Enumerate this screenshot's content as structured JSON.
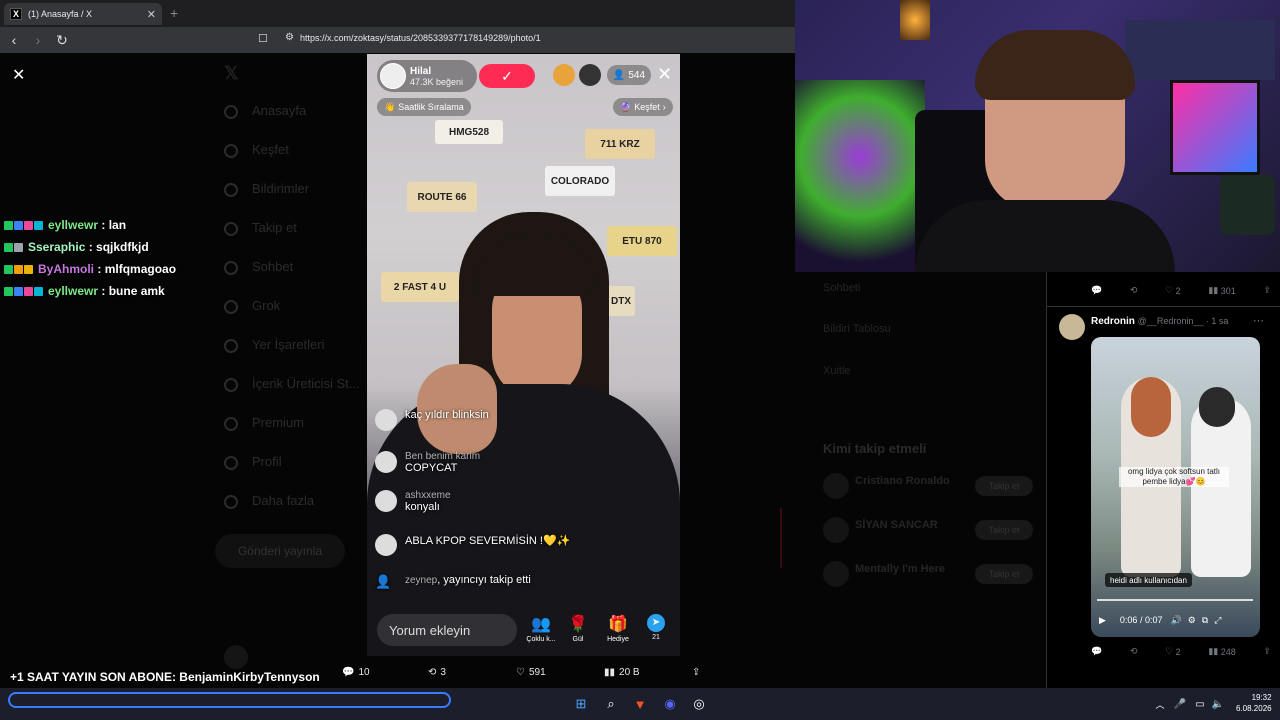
{
  "browser": {
    "tab_title": "(1) Anasayfa / X",
    "favicon": "X",
    "tab_close": "✕",
    "new_tab": "+",
    "url": "https://x.com/zoktasy/status/2085339377178149289/photo/1"
  },
  "x_sidebar": {
    "items": [
      "Anasayfa",
      "Keşfet",
      "Bildirimler",
      "Takip et",
      "Sohbet",
      "Grok",
      "Yer İşaretleri",
      "İçerik Üreticisi St...",
      "Premium",
      "Profil",
      "Daha fazla"
    ],
    "post_button": "Gönderi yayınla"
  },
  "x_right": {
    "rows": [
      "Sohbeti",
      "Bildiri Tablosu",
      "Xuitle"
    ],
    "who_to_follow": "Kimi takip etmeli",
    "suggestions": [
      "Cristiano Ronaldo",
      "SİYAN SANCAR",
      "Mentally I'm Here"
    ],
    "follow_label": "Takip et"
  },
  "chat": [
    {
      "user": "eyllwewr",
      "msg": "lan",
      "color": "#7ee787"
    },
    {
      "user": "Sseraphic",
      "msg": "sqjkdfkjd",
      "color": "#a5f3c4"
    },
    {
      "user": "ByAhmoli",
      "msg": "mlfqmagoao",
      "color": "#c678dd"
    },
    {
      "user": "eyllwewr",
      "msg": "bune amk",
      "color": "#7ee787"
    }
  ],
  "live": {
    "host_name": "Hilal",
    "host_likes": "47.3K beğeni",
    "follow_icon": "✓",
    "viewers": "544",
    "tag_left": "Saatlik Sıralama",
    "tag_right": "Keşfet",
    "plates": [
      "HMG528",
      "ROUTE 66",
      "COLORADO",
      "ETU 870",
      "2 FAST 4 U",
      "DTX",
      "711 KRZ"
    ],
    "comments": [
      {
        "user": "",
        "text": "kaç yıldır blinksin"
      },
      {
        "user": "Ben benim karim",
        "text": "COPYCAT"
      },
      {
        "user": "ashxxeme",
        "text": "konyalı"
      },
      {
        "user": "",
        "text": "ABLA KPOP SEVERMİSİN !💛✨"
      },
      {
        "user": "zeynep",
        "text": ", yayıncıyı takip etti"
      }
    ],
    "comment_placeholder": "Yorum ekleyin",
    "actions": [
      {
        "label": "Çoklu k...",
        "icon": "👥"
      },
      {
        "label": "Gül",
        "icon": "🌹"
      },
      {
        "label": "Hediye",
        "icon": "🎁"
      },
      {
        "label": "21",
        "icon": "➤"
      }
    ]
  },
  "tweet": {
    "name": "Redronin",
    "handle": "@__Redronin__ · 1 sa",
    "top_stats": {
      "replies": "",
      "retweets": "",
      "likes": "2",
      "views": "301"
    },
    "caption": "omg lidya çok softsun tatlı pembe lidya💕😊",
    "attribution": "heidi adlı kullanıcıdan",
    "time": "0:06 / 0:07",
    "bottom_stats": {
      "likes": "2",
      "views": "248"
    }
  },
  "post_stats": {
    "replies": "10",
    "reposts": "3",
    "likes": "591",
    "views": "20 B"
  },
  "sub_banner": "+1 SAAT YAYIN SON ABONE: BenjaminKirbyTennyson",
  "clock": {
    "time": "19:32",
    "date": "6.08.2026"
  }
}
